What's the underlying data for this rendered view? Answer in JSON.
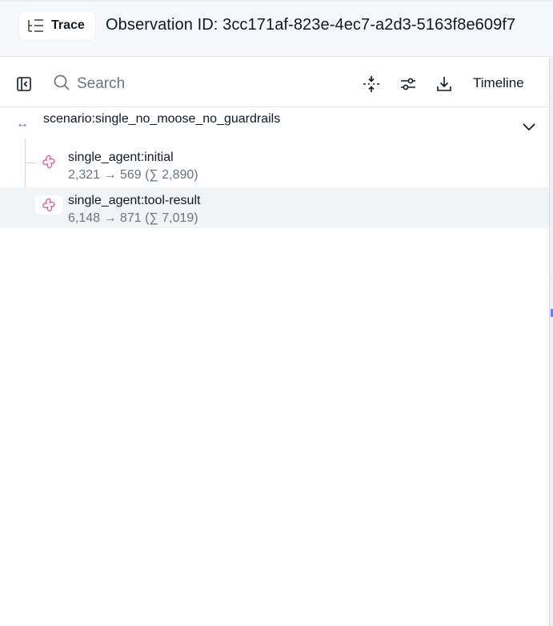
{
  "header": {
    "badge_label": "Trace",
    "observation_title": "Observation ID: 3cc171af-823e-4ec7-a2d3-5163f8e609f7"
  },
  "toolbar": {
    "search_placeholder": "Search",
    "timeline_label": "Timeline",
    "icons": [
      "panel-toggle-icon",
      "search-icon",
      "collapse-icon",
      "filter-icon",
      "download-icon"
    ]
  },
  "tree": {
    "root": {
      "name": "scenario:single_no_moose_no_guardrails",
      "icon": "span-arrows-icon",
      "expanded": true
    },
    "children": [
      {
        "name": "single_agent:initial",
        "tokens": "2,321 → 569 (∑ 2,890)",
        "icon": "generation-icon",
        "selected": false
      },
      {
        "name": "single_agent:tool-result",
        "tokens": "6,148 → 871 (∑ 7,019)",
        "icon": "generation-icon",
        "selected": true
      }
    ]
  },
  "colors": {
    "accent": "#6366f1",
    "generation": "#e0559a",
    "selected_row": "#f1f4f7",
    "muted_text": "#6b7280"
  }
}
